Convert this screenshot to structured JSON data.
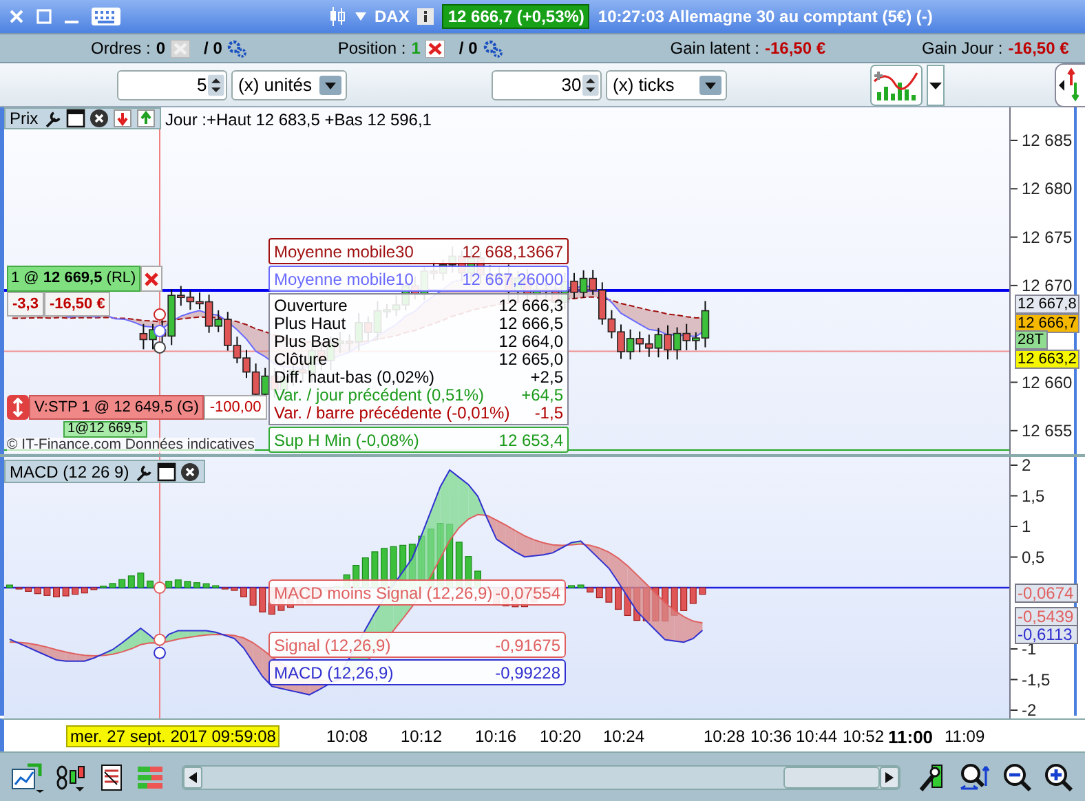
{
  "window": {
    "symbol": "DAX",
    "price_badge": "12 666,7 (+0,53%)",
    "title": "10:27:03 Allemagne 30 au comptant (5€) (-)"
  },
  "account_bar": [
    {
      "kind": "count",
      "label": "Ordres :",
      "value": "0",
      "active": false,
      "pending": "/ 0"
    },
    {
      "kind": "count",
      "label": "Position :",
      "value": "1",
      "active": true,
      "pending": "/ 0"
    },
    {
      "kind": "amount",
      "label": "Gain latent :",
      "value": "-16,50 €"
    },
    {
      "kind": "amount",
      "label": "Gain Jour :",
      "value": "-16,50 €"
    }
  ],
  "order_bar": {
    "quantity": "5",
    "quantity_unit": "(x) unités",
    "distance": "30",
    "distance_unit": "(x) ticks"
  },
  "price_panel": {
    "title": "Prix",
    "day_range": "Jour :+Haut 12 683,5 +Bas 12 596,1",
    "axis_ticks": [
      "12 685",
      "12 680",
      "12 675",
      "12 670",
      "12 660",
      "12 655"
    ],
    "position": {
      "label": "1 @ **12 669,5** (RL)",
      "ticks": "-3,3",
      "pnl": "-16,50 €",
      "label_2": "1@12 669,5"
    },
    "stop": {
      "label": "V:STP  1 @ 12 649,5 (G)",
      "pnl": "-100,00"
    },
    "legend": [
      {
        "name": "Moyenne mobile30",
        "value": "12 668,13667",
        "color": "#a01010"
      },
      {
        "name": "Moyenne mobile10",
        "value": "12 667,26000",
        "color": "#6a6aff"
      }
    ],
    "ohlc": [
      {
        "label": "Ouverture",
        "value": "12 666,3",
        "color": "#000000"
      },
      {
        "label": "Plus Haut",
        "value": "12 666,5",
        "color": "#000000"
      },
      {
        "label": "Plus Bas",
        "value": "12 664,0",
        "color": "#000000"
      },
      {
        "label": "Clôture",
        "value": "12 665,0",
        "color": "#000000"
      },
      {
        "label": "Diff. haut-bas (0,02%)",
        "value": "+2,5",
        "color": "#000000"
      },
      {
        "label": "Var. / jour précédent (0,51%)",
        "value": "+64,5",
        "color": "#1a9a1a"
      },
      {
        "label": "Var. / barre précédente (-0,01%)",
        "value": "-1,5",
        "color": "#b00000"
      }
    ],
    "support": {
      "name": "Sup H Min (-0,08%)",
      "value": "12 653,4"
    },
    "price_tags": [
      {
        "text": "12 667,8",
        "color": "#e4e8f0"
      },
      {
        "text": "12 666,7",
        "color": "#f5b800"
      },
      {
        "text": "28T",
        "color": "#90dc90"
      },
      {
        "text": "12 663,2",
        "color": "#f6f600"
      }
    ],
    "copyright": "© IT-Finance.com Données indicatives"
  },
  "macd_panel": {
    "title": "MACD (12 26 9)",
    "axis_ticks": [
      "2",
      "1,5",
      "1",
      "0,5",
      "-1",
      "-1,5",
      "-2"
    ],
    "legend": [
      {
        "name": "MACD moins Signal (12,26,9)",
        "value": "-0,07554",
        "color": "#e06060"
      },
      {
        "name": "Signal (12,26,9)",
        "value": "-0,91675",
        "color": "#e06060"
      },
      {
        "name": "MACD (12,26,9)",
        "value": "-0,99228",
        "color": "#3030d0"
      }
    ],
    "value_tags": [
      {
        "text": "-0,0674",
        "color": "#e06060"
      },
      {
        "text": "-0,5439",
        "color": "#e06060"
      },
      {
        "text": "-0,6113",
        "color": "#3030d0"
      }
    ]
  },
  "time_axis": {
    "cursor_label": "mer. 27 sept. 2017 09:59:08",
    "labels": [
      {
        "text": "10:08",
        "major": false
      },
      {
        "text": "10:12",
        "major": false
      },
      {
        "text": "10:16",
        "major": false
      },
      {
        "text": "10:20",
        "major": false
      },
      {
        "text": "10:24",
        "major": false
      },
      {
        "text": "10:28",
        "major": false
      },
      {
        "text": "10:36",
        "major": false
      },
      {
        "text": "10:44",
        "major": false
      },
      {
        "text": "10:52",
        "major": false
      },
      {
        "text": "11:00",
        "major": true
      },
      {
        "text": "11:09",
        "major": false
      }
    ]
  }
}
